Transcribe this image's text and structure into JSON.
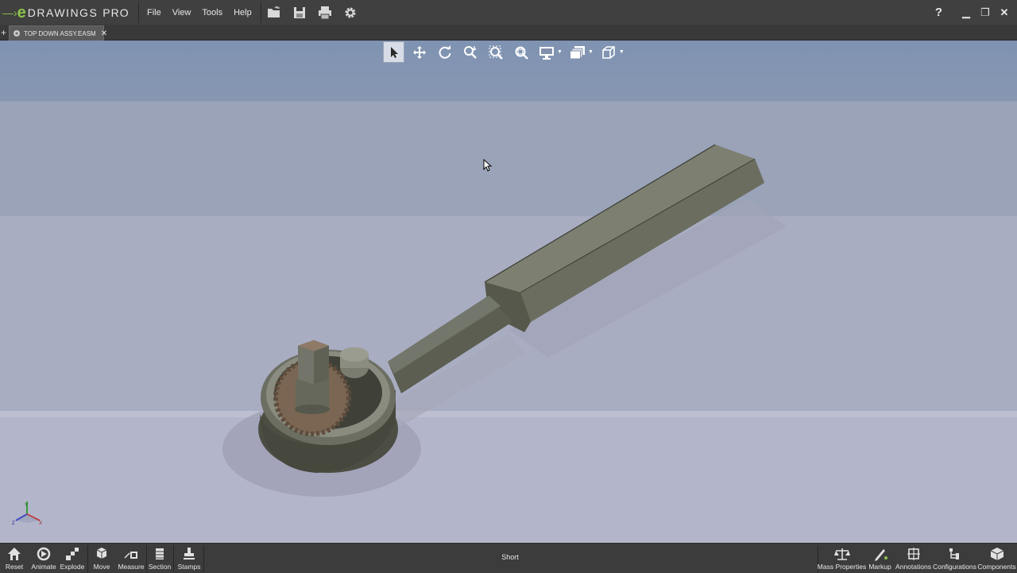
{
  "app": {
    "logo_word": "DRAWINGS",
    "logo_suffix": "PRO",
    "menu": [
      "File",
      "View",
      "Tools",
      "Help"
    ],
    "toolbar_icons": [
      "open-folder-icon",
      "save-icon",
      "print-icon",
      "settings-gear-icon"
    ],
    "help_label": "?",
    "window_controls": [
      "minimize-icon",
      "restore-icon",
      "close-icon"
    ]
  },
  "tabs": [
    {
      "label": "TOP DOWN ASSY.EASM",
      "active": true
    }
  ],
  "view_toolbar": [
    "select-arrow-icon",
    "pan-icon",
    "rotate-icon",
    "zoom-icon",
    "zoom-to-fit-icon",
    "zoom-to-area-icon",
    "display-style-icon",
    "views-icon",
    "standard-view-icon"
  ],
  "bottom_toolbar": {
    "left": [
      {
        "label": "Reset",
        "icon": "home-icon"
      },
      {
        "label": "Animate",
        "icon": "animate-icon"
      },
      {
        "label": "Explode",
        "icon": "explode-icon"
      },
      {
        "label": "Move",
        "icon": "move-icon"
      },
      {
        "label": "Measure",
        "icon": "measure-icon"
      },
      {
        "label": "Section",
        "icon": "section-icon"
      },
      {
        "label": "Stamps",
        "icon": "stamp-icon"
      }
    ],
    "configuration_name": "Short",
    "right": [
      {
        "label": "Mass Properties",
        "icon": "scale-icon"
      },
      {
        "label": "Markup",
        "icon": "markup-pen-icon"
      },
      {
        "label": "Annotations",
        "icon": "annotations-icon"
      },
      {
        "label": "Configurations",
        "icon": "configurations-icon"
      },
      {
        "label": "Components",
        "icon": "components-icon"
      }
    ]
  },
  "colors": {
    "accent": "#8bc34a",
    "chrome": "#404040",
    "viewport_top": "#7f93b2",
    "viewport_bottom": "#b2b6cb"
  }
}
